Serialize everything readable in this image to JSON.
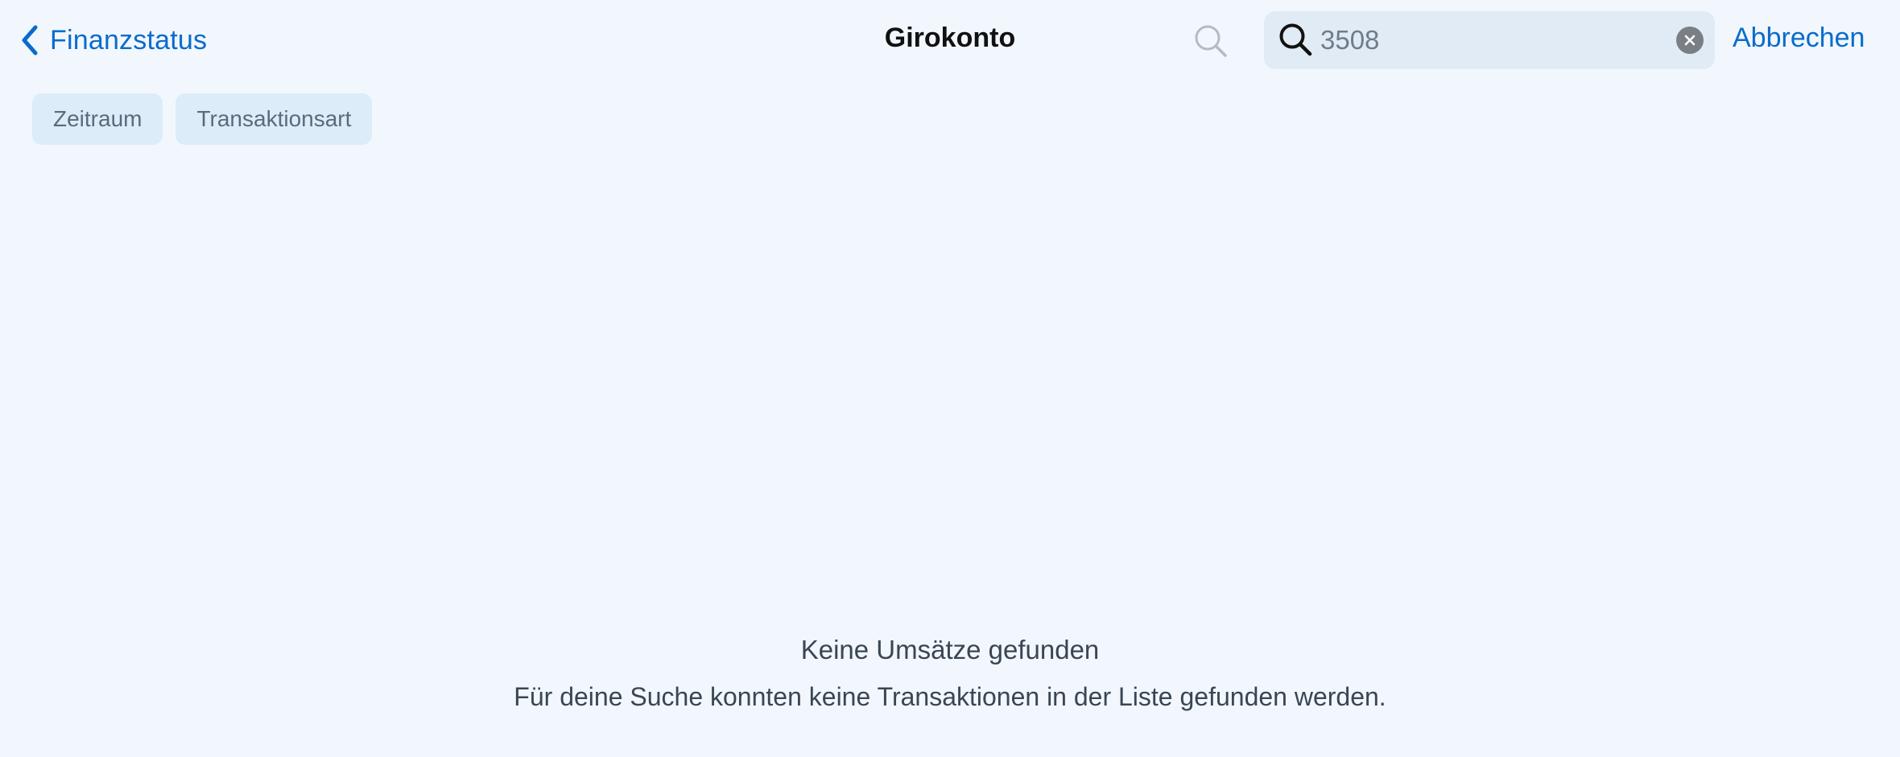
{
  "header": {
    "back_label": "Finanzstatus",
    "title": "Girokonto",
    "cancel_label": "Abbrechen"
  },
  "search": {
    "value": "3508",
    "placeholder": ""
  },
  "filters": [
    {
      "label": "Zeitraum"
    },
    {
      "label": "Transaktionsart"
    }
  ],
  "empty_state": {
    "title": "Keine Umsätze gefunden",
    "message": "Für deine Suche konnten keine Transaktionen in der Liste gefunden werden."
  },
  "icons": {
    "back": "chevron-left-icon",
    "search_ghost": "search-icon",
    "search_field": "search-icon",
    "clear": "close-icon"
  },
  "colors": {
    "background": "#f1f7fd",
    "accent": "#0b6bcb",
    "chip_bg": "#dcecf9",
    "search_bg": "#e1ebf5"
  }
}
